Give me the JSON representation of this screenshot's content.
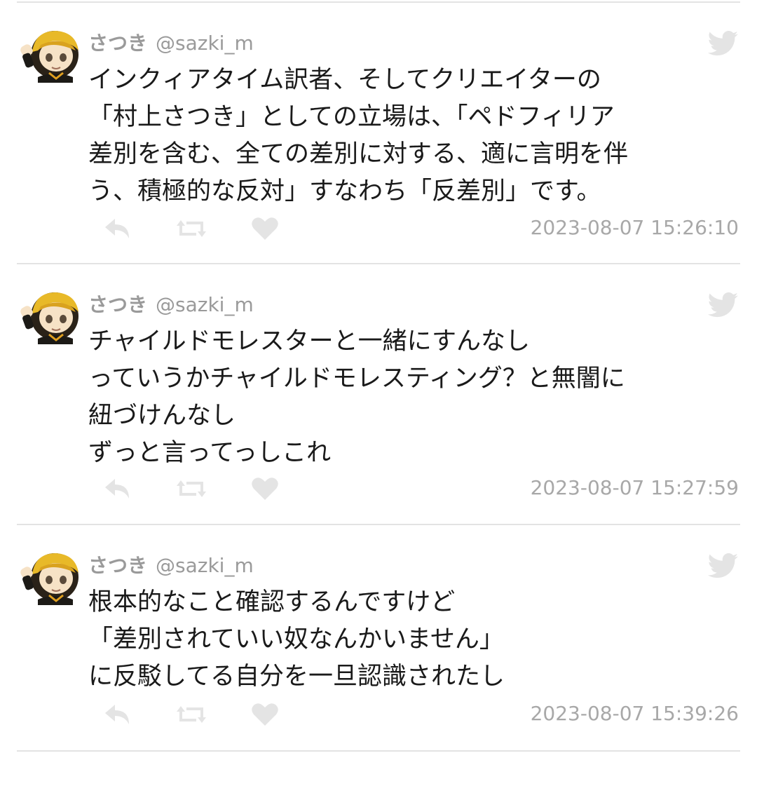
{
  "colors": {
    "name": "#9a9a9a",
    "body": "#1a1a1a",
    "icon": "#e4e4e4",
    "timestamp": "#a8a8a8",
    "divider": "#e3e3e3"
  },
  "icons": {
    "avatar": "avatar-image",
    "bird": "bird-icon",
    "reply": "reply-icon",
    "retweet": "retweet-icon",
    "like": "heart-icon"
  },
  "tweets": [
    {
      "display_name": "さつき",
      "handle": "@sazki_m",
      "text": "インクィアタイム訳者、そしてクリエイターの\n「村上さつき」としての立場は、「ペドフィリア\n差別を含む、全ての差別に対する、適に言明を伴\nう、積極的な反対」すなわち「反差別」です。",
      "timestamp": "2023-08-07 15:26:10"
    },
    {
      "display_name": "さつき",
      "handle": "@sazki_m",
      "text": "チャイルドモレスターと一緒にすんなし\nっていうかチャイルドモレスティング？と無闇に\n紐づけんなし\nずっと言ってっしこれ",
      "timestamp": "2023-08-07 15:27:59"
    },
    {
      "display_name": "さつき",
      "handle": "@sazki_m",
      "text": "根本的なこと確認するんですけど\n「差別されていい奴なんかいません」\nに反駁してる自分を一旦認識されたし",
      "timestamp": "2023-08-07 15:39:26"
    }
  ]
}
